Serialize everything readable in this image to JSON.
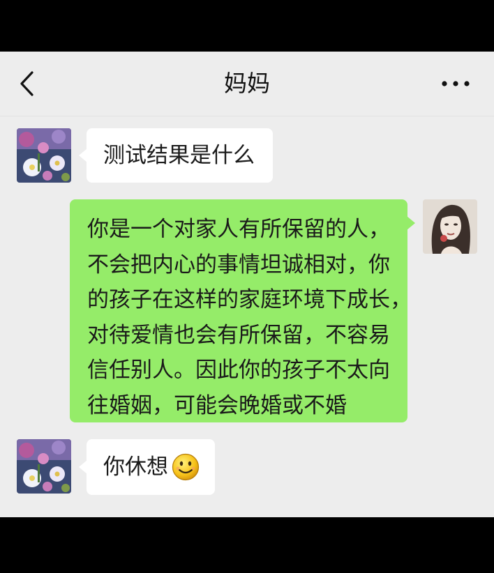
{
  "header": {
    "title": "妈妈",
    "back_icon": "chevron-left-icon",
    "more_icon": "more-horizontal-icon"
  },
  "messages": [
    {
      "sender": "mom",
      "direction": "incoming",
      "lines": [
        "测试结果是什么"
      ]
    },
    {
      "sender": "self",
      "direction": "outgoing",
      "lines": [
        "你是一个对家人有所保留的人，",
        "不会把内心的事情坦诚相对，你",
        "的孩子在这样的家庭环境下成长，",
        "对待爱情也会有所保留，不容易",
        "信任别人。因此你的孩子不太向",
        "往婚姻，可能会晚婚或不婚"
      ]
    },
    {
      "sender": "mom",
      "direction": "incoming",
      "lines": [
        "你休想"
      ],
      "emoji": "smile-emoji"
    }
  ],
  "colors": {
    "background": "#ededed",
    "incoming_bubble": "#ffffff",
    "outgoing_bubble": "#95ec69",
    "text": "#1a1a1a"
  }
}
